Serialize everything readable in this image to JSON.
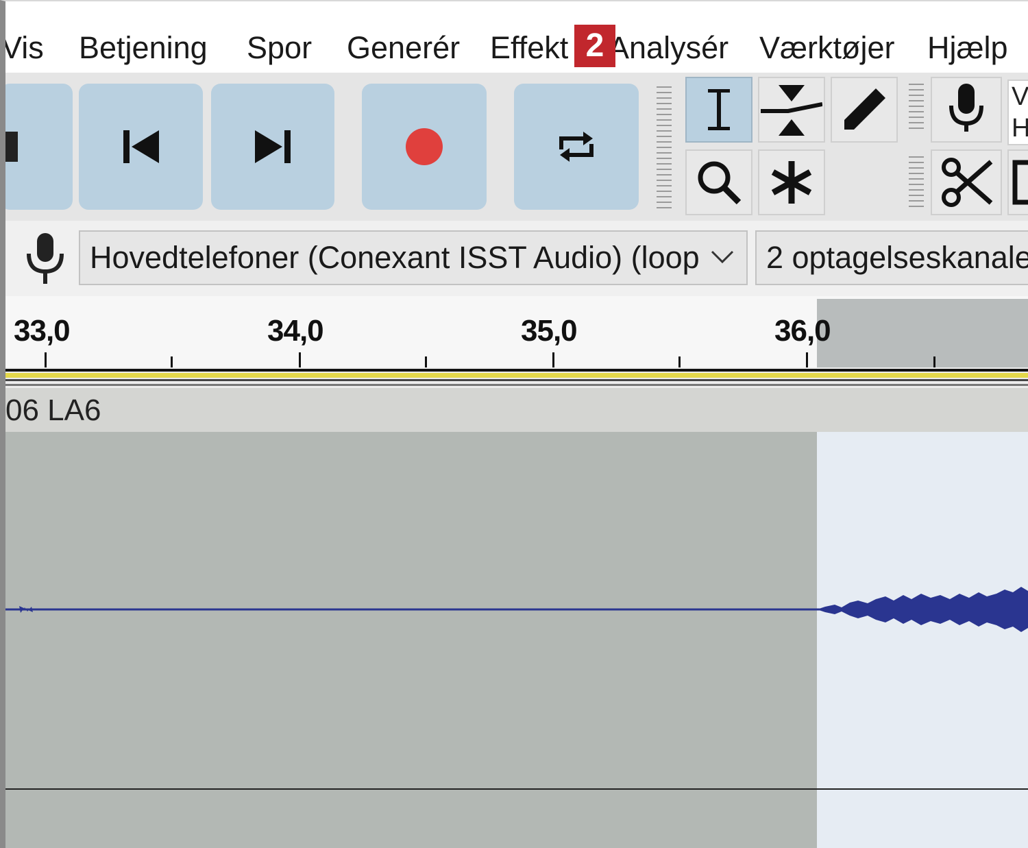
{
  "menu": {
    "items": [
      "Vis",
      "Betjening",
      "Spor",
      "Generér",
      "Effekt",
      "Analysér",
      "Værktøjer",
      "Hjælp"
    ],
    "badge": "2"
  },
  "transport": {
    "buttons": [
      "stop-icon",
      "skip-to-start-icon",
      "skip-to-end-icon",
      "record-icon",
      "loop-icon"
    ],
    "record_color": "#e0403d",
    "button_color": "#b9d0e0"
  },
  "tools": {
    "items": [
      "selection-tool-icon",
      "envelope-tool-icon",
      "draw-tool-icon",
      "zoom-tool-icon",
      "multi-tool-icon"
    ],
    "active": "selection-tool-icon"
  },
  "meter_stub": {
    "line1": "V",
    "line2": "H"
  },
  "device": {
    "recording_device": "Hovedtelefoner (Conexant ISST Audio) (loop",
    "channels": "2 optagelseskanale"
  },
  "ruler": {
    "labels": [
      "33,0",
      "34,0",
      "35,0",
      "36,0"
    ]
  },
  "track": {
    "clip_name": "06 LA6",
    "waveform_color": "#2a3590",
    "selection_color": "#e6ecf3",
    "background_color": "#b3b8b4"
  }
}
